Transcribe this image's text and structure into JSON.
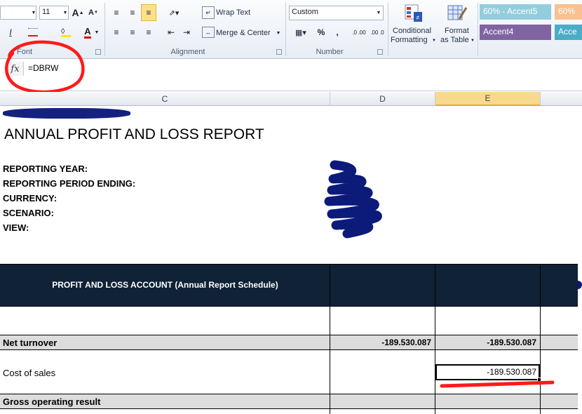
{
  "ribbon": {
    "font_size": "11",
    "font_group_label": "Font",
    "alignment_group_label": "Alignment",
    "number_group_label": "Number",
    "wrap_text_label": "Wrap Text",
    "merge_center_label": "Merge & Center",
    "number_format": "Custom",
    "percent_symbol": "%",
    "comma_symbol": ",",
    "increase_decimal_label": ".0 .00",
    "decrease_decimal_label": ".00 .0",
    "conditional_formatting_label_1": "Conditional",
    "conditional_formatting_label_2": "Formatting",
    "format_table_label_1": "Format",
    "format_table_label_2": "as Table",
    "styles": [
      {
        "label": "60% - Accent5",
        "bg": "#93cddd",
        "fg": "#ffffff"
      },
      {
        "label": "60%",
        "bg": "#fac090",
        "fg": "#ffffff"
      },
      {
        "label": "Accent4",
        "bg": "#8064a2",
        "fg": "#ffffff"
      },
      {
        "label": "Acce",
        "bg": "#4bacc6",
        "fg": "#ffffff"
      }
    ]
  },
  "formula_bar": {
    "fx_label": "fx",
    "formula": "=DBRW"
  },
  "columns": {
    "c": "C",
    "d": "D",
    "e": "E"
  },
  "report": {
    "title": "ANNUAL PROFIT AND LOSS  REPORT",
    "meta_labels": [
      "REPORTING YEAR:",
      "REPORTING PERIOD ENDING:",
      "CURRENCY:",
      "SCENARIO:",
      "VIEW:"
    ],
    "table_header": "PROFIT AND LOSS ACCOUNT (Annual Report Schedule)",
    "rows": [
      {
        "label": "Net turnover",
        "d": "-189.530.087",
        "e": "-189.530.087",
        "bold": true
      },
      {
        "label": "Cost of sales",
        "d": "",
        "e": "-189.530.087",
        "bold": false
      },
      {
        "label": "Gross operating result",
        "d": "",
        "e": "",
        "bold": true
      }
    ]
  },
  "colors": {
    "header_fill": "#0f2236",
    "selected_column_header": "#f9d98c",
    "annotation_red": "#ff1a1a",
    "redaction_blue": "#0c1a7a"
  }
}
